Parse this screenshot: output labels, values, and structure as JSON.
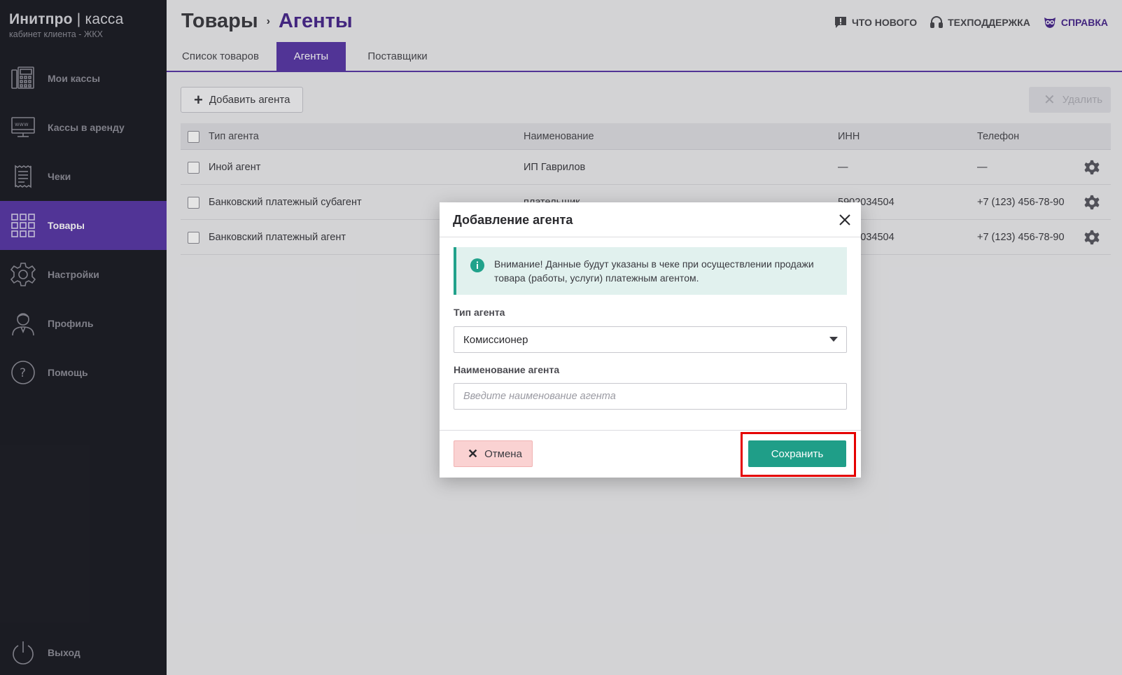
{
  "brand": {
    "name": "Инитпро",
    "separator": "|",
    "suffix": "касса",
    "subtitle": "кабинет клиента - ЖКХ"
  },
  "sidebar": {
    "items": [
      {
        "label": "Мои кассы",
        "icon": "cash-register-icon"
      },
      {
        "label": "Кассы в аренду",
        "icon": "web-terminal-icon"
      },
      {
        "label": "Чеки",
        "icon": "receipt-icon"
      },
      {
        "label": "Товары",
        "icon": "grid-icon",
        "active": true
      },
      {
        "label": "Настройки",
        "icon": "gear-icon"
      },
      {
        "label": "Профиль",
        "icon": "user-icon"
      },
      {
        "label": "Помощь",
        "icon": "help-icon"
      }
    ],
    "logout": {
      "label": "Выход",
      "icon": "power-icon"
    }
  },
  "header": {
    "breadcrumb_root": "Товары",
    "breadcrumb_sep": "›",
    "breadcrumb_current": "Агенты",
    "links": [
      {
        "label": "ЧТО НОВОГО",
        "icon": "chat-alert-icon"
      },
      {
        "label": "ТЕХПОДДЕРЖКА",
        "icon": "headset-icon"
      },
      {
        "label": "СПРАВКА",
        "icon": "owl-icon",
        "accent": "#4b2b8e"
      }
    ]
  },
  "tabs": [
    {
      "label": "Список товаров"
    },
    {
      "label": "Агенты",
      "active": true
    },
    {
      "label": "Поставщики"
    }
  ],
  "toolbar": {
    "add_label": "Добавить агента",
    "delete_label": "Удалить"
  },
  "table": {
    "columns": [
      "Тип агента",
      "Наименование",
      "ИНН",
      "Телефон"
    ],
    "rows": [
      {
        "type": "Иной агент",
        "name": "ИП Гаврилов",
        "inn": "—",
        "phone": "—"
      },
      {
        "type": "Банковский платежный субагент",
        "name": "плательщик",
        "inn": "5902034504",
        "phone": "+7 (123) 456-78-90"
      },
      {
        "type": "Банковский платежный агент",
        "name": "",
        "inn": "5902034504",
        "phone": "+7 (123) 456-78-90"
      }
    ]
  },
  "modal": {
    "title": "Добавление агента",
    "notice": "Внимание! Данные будут указаны в чеке при осуществлении продажи товара (работы, услуги) платежным агентом.",
    "type_label": "Тип агента",
    "type_value": "Комиссионер",
    "name_label": "Наименование агента",
    "name_placeholder": "Введите наименование агента",
    "cancel_label": "Отмена",
    "save_label": "Сохранить"
  },
  "colors": {
    "accent": "#5b3aa8",
    "save": "#1f9e88",
    "highlight": "#e50000"
  }
}
